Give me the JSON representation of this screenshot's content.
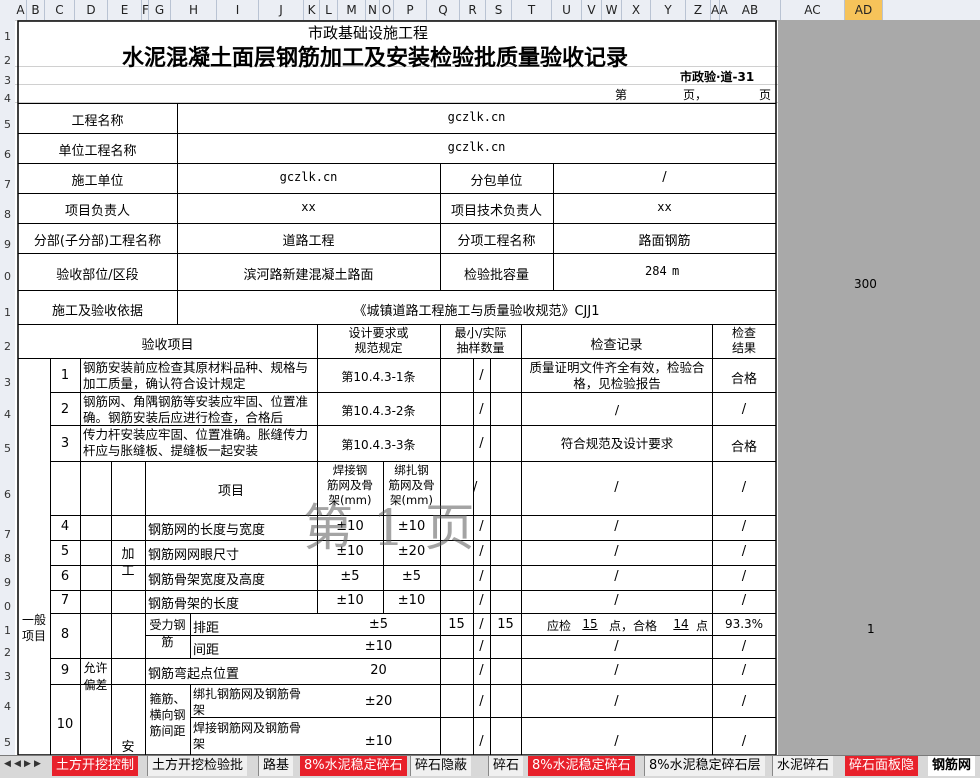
{
  "columns": [
    "A",
    "B",
    "C",
    "D",
    "E",
    "F",
    "G",
    "H",
    "I",
    "J",
    "K",
    "L",
    "M",
    "N",
    "O",
    "P",
    "Q",
    "R",
    "S",
    "T",
    "U",
    "V",
    "W",
    "X",
    "Y",
    "Z",
    "AA",
    "AB",
    "AC",
    "AD"
  ],
  "rows": [
    "1",
    "2",
    "3",
    "4",
    "5",
    "6",
    "7",
    "8",
    "9",
    "0",
    "1",
    "2",
    "3",
    "4",
    "5",
    "6",
    "7",
    "8",
    "9",
    "0",
    "1",
    "2",
    "3",
    "4",
    "5",
    "6"
  ],
  "doc": {
    "header_small": "市政基础设施工程",
    "title": "水泥混凝土面层钢筋加工及安装检验批质量验收记录",
    "code": "市政验·道-31",
    "page_di": "第",
    "page_ye": "页，",
    "page_gong": "页",
    "watermark": "第 1 页"
  },
  "info": {
    "project_name_label": "工程名称",
    "project_name": "gczlk.cn",
    "unit_project_label": "单位工程名称",
    "unit_project": "gczlk.cn",
    "contractor_label": "施工单位",
    "contractor": "gczlk.cn",
    "sub_contractor_label": "分包单位",
    "sub_contractor": "/",
    "pm_label": "项目负责人",
    "pm": "xx",
    "tech_label": "项目技术负责人",
    "tech": "xx",
    "division_label": "分部(子分部)工程名称",
    "division": "道路工程",
    "item_label": "分项工程名称",
    "item": "路面钢筋",
    "location_label": "验收部位/区段",
    "location": "滨河路新建混凝土路面",
    "capacity_label": "检验批容量",
    "capacity": "284",
    "capacity_unit": "m",
    "basis_label": "施工及验收依据",
    "basis": "《城镇道路工程施工与质量验收规范》CJJ1"
  },
  "table_head": {
    "item": "验收项目",
    "spec": "设计要求或\n规范规定",
    "count": "最小/实际\n抽样数量",
    "record": "检查记录",
    "result": "检查\n结果"
  },
  "rows_main": [
    {
      "no": "1",
      "text": "钢筋安装前应检查其原材料品种、规格与加工质量，确认符合设计规定",
      "spec": "第10.4.3-1条",
      "slash": "/",
      "record": "质量证明文件齐全有效，检验合格，见检验报告",
      "result": "合格"
    },
    {
      "no": "2",
      "text": "钢筋网、角隅钢筋等安装应牢固、位置准确。钢筋安装后应进行检查，合格后",
      "spec": "第10.4.3-2条",
      "slash": "/",
      "record": "/",
      "result": "/"
    },
    {
      "no": "3",
      "text": "传力杆安装应牢固、位置准确。胀缝传力杆应与胀缝板、提缝板一起安装",
      "spec": "第10.4.3-3条",
      "slash": "/",
      "record": "符合规范及设计要求",
      "result": "合格"
    }
  ],
  "general": {
    "label": "一般\n项目",
    "allow": "允许\n偏差",
    "proc": "加\n工",
    "inst": "安",
    "item_head": "项目",
    "weld_head": "焊接钢\n筋网及骨\n架(mm)",
    "bind_head": "绑扎钢\n筋网及骨\n架(mm)"
  },
  "rows_general": [
    {
      "no": "4",
      "name": "钢筋网的长度与宽度",
      "weld": "±10",
      "bind": "±10",
      "slash": "/",
      "record": "/",
      "result": "/"
    },
    {
      "no": "5",
      "name": "钢筋网网眼尺寸",
      "weld": "±10",
      "bind": "±20",
      "slash": "/",
      "record": "/",
      "result": "/"
    },
    {
      "no": "6",
      "name": "钢筋骨架宽度及高度",
      "weld": "±5",
      "bind": "±5",
      "slash": "/",
      "record": "/",
      "result": "/"
    },
    {
      "no": "7",
      "name": "钢筋骨架的长度",
      "weld": "±10",
      "bind": "±10",
      "slash": "/",
      "record": "/",
      "result": "/"
    }
  ],
  "row8": {
    "no": "8",
    "group": "受力钢\n筋",
    "a_name": "排距",
    "a_spec": "±5",
    "a_min": "15",
    "a_slash": "/",
    "a_actual": "15",
    "a_check": "应检",
    "a_checked": "15",
    "a_point": "点，合格",
    "a_ok": "14",
    "a_point2": "点",
    "a_result": "93.3%",
    "b_name": "间距",
    "b_spec": "±10",
    "b_slash": "/",
    "b_record": "/",
    "b_result": "/"
  },
  "row9": {
    "no": "9",
    "name": "钢筋弯起点位置",
    "spec": "20",
    "slash": "/",
    "record": "/",
    "result": "/"
  },
  "row10": {
    "no": "10",
    "group": "箍筋、\n横向钢\n筋间距",
    "a_name": "绑扎钢筋网及钢筋骨\n架",
    "a_spec": "±20",
    "a_slash": "/",
    "a_record": "/",
    "a_result": "/",
    "b_name": "焊接钢筋网及钢筋骨\n架",
    "b_spec": "±10",
    "b_slash": "/",
    "b_record": "/",
    "b_result": "/"
  },
  "side_values": {
    "v300": "300",
    "v1": "1"
  },
  "tabs": [
    {
      "label": "土方开挖控制",
      "style": "red"
    },
    {
      "label": "土方开挖检验批",
      "style": "plain"
    },
    {
      "label": "路基",
      "style": "plain"
    },
    {
      "label": "8%水泥稳定碎石",
      "style": "red"
    },
    {
      "label": "碎石隐蔽",
      "style": "plain"
    },
    {
      "label": "碎石",
      "style": "plain"
    },
    {
      "label": "8%水泥稳定碎石",
      "style": "red"
    },
    {
      "label": "8%水泥稳定碎石层",
      "style": "plain"
    },
    {
      "label": "水泥碎石",
      "style": "plain"
    },
    {
      "label": "碎石面板隐",
      "style": "red"
    },
    {
      "label": "钢筋网",
      "style": "active"
    }
  ]
}
